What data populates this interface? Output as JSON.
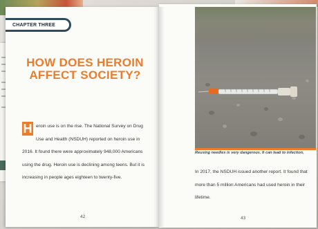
{
  "chapter_label": "CHAPTER THREE",
  "title": "HOW DOES HEROIN AFFECT SOCIETY?",
  "left_page": {
    "dropcap": "H",
    "body": "eroin use is on the rise. The National Survey on Drug Use and Health (NSDUH) reported on heroin use in 2016. It found there were approximately 948,000 Americans using the drug. Heroin use is declining among teens. But it is increasing in people ages eighteen to twenty-five.",
    "page_number": "42"
  },
  "right_page": {
    "caption": "Reusing needles is very dangerous. It can lead to infection.",
    "body": "In 2017, the NSDUH issued another report. It found that more than 5 million Americans had used heroin in their lifetime.",
    "page_number": "43"
  },
  "colors": {
    "accent": "#ea7c2c",
    "navy": "#2f4a5a",
    "paper": "#fbfbf8"
  }
}
